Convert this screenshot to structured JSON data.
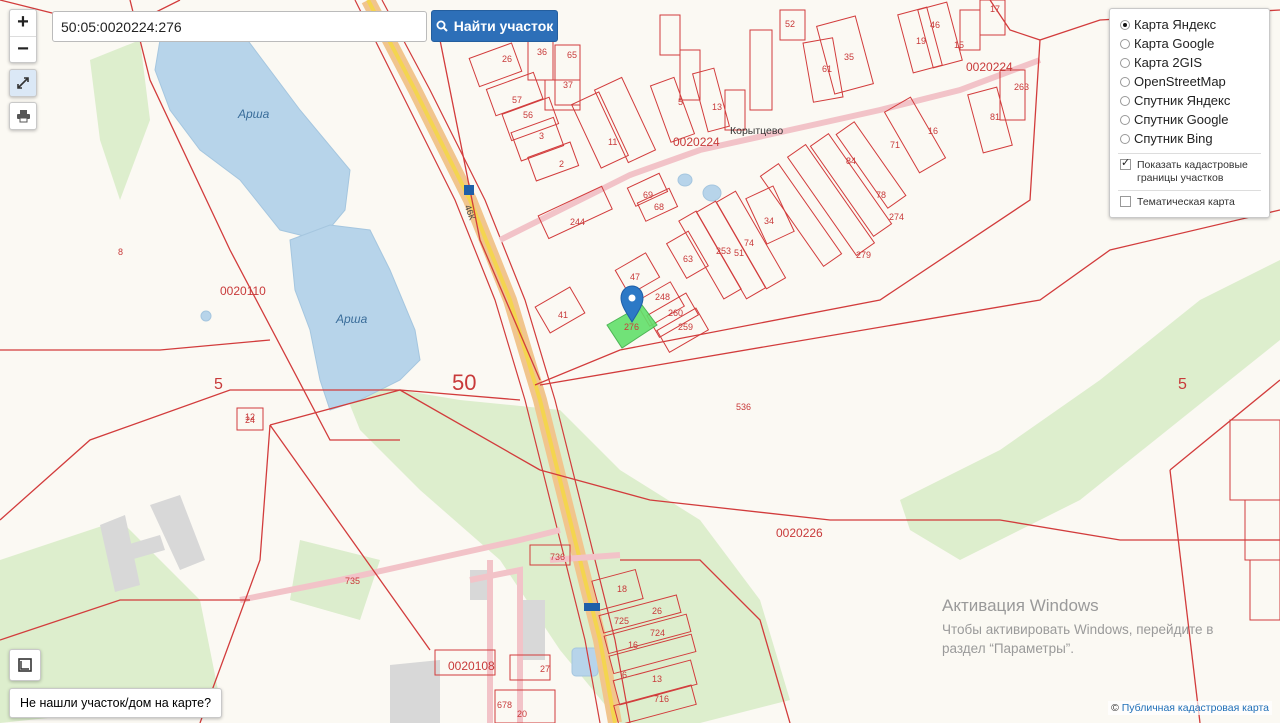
{
  "search": {
    "value": "50:05:0020224:276",
    "button_label": "Найти участок"
  },
  "zoom": {
    "in_label": "+",
    "out_label": "−"
  },
  "layers": {
    "base_maps": [
      "Карта Яндекс",
      "Карта Google",
      "Карта 2GIS",
      "OpenStreetMap",
      "Спутник Яндекс",
      "Спутник Google",
      "Спутник Bing"
    ],
    "selected_base_map": "Карта Яндекс",
    "show_cadastre_label": "Показать кадастровые границы участков",
    "show_cadastre_checked": true,
    "thematic_label": "Тематическая карта",
    "thematic_checked": false
  },
  "not_found_label": "Не нашли участок/дом на карте?",
  "attribution": {
    "prefix": "©",
    "link_text": "Публичная кадастровая карта"
  },
  "watermark": {
    "title": "Активация Windows",
    "text": "Чтобы активировать Windows, перейдите в раздел “Параметры”."
  },
  "map": {
    "lake_labels": [
      "Арша",
      "Арша"
    ],
    "village_label": "Корытцево",
    "region_label": "50",
    "quarter_labels": [
      "0020224",
      "0020224",
      "0020110",
      "0020226",
      "0020108"
    ],
    "parcel_labels": [
      "8",
      "5",
      "5",
      "536",
      "24",
      "41",
      "47",
      "248",
      "260",
      "259",
      "276",
      "63",
      "244",
      "69",
      "68",
      "34",
      "74",
      "51",
      "253",
      "11",
      "5",
      "13",
      "57",
      "56",
      "3",
      "2",
      "26",
      "36",
      "37",
      "65",
      "19",
      "46",
      "15",
      "17",
      "52",
      "35",
      "61",
      "16",
      "84",
      "71",
      "78",
      "274",
      "279",
      "81",
      "263",
      "736",
      "735",
      "18",
      "26",
      "725",
      "724",
      "16",
      "6",
      "13",
      "716",
      "27",
      "20",
      "678",
      "12",
      "24"
    ],
    "road_label": "46К"
  },
  "colors": {
    "button": "#2d6fb8",
    "parcel_border": "#d23c3c",
    "water": "#b7d4ea",
    "selected_parcel": "#63e06b",
    "marker": "#2c79c6"
  }
}
